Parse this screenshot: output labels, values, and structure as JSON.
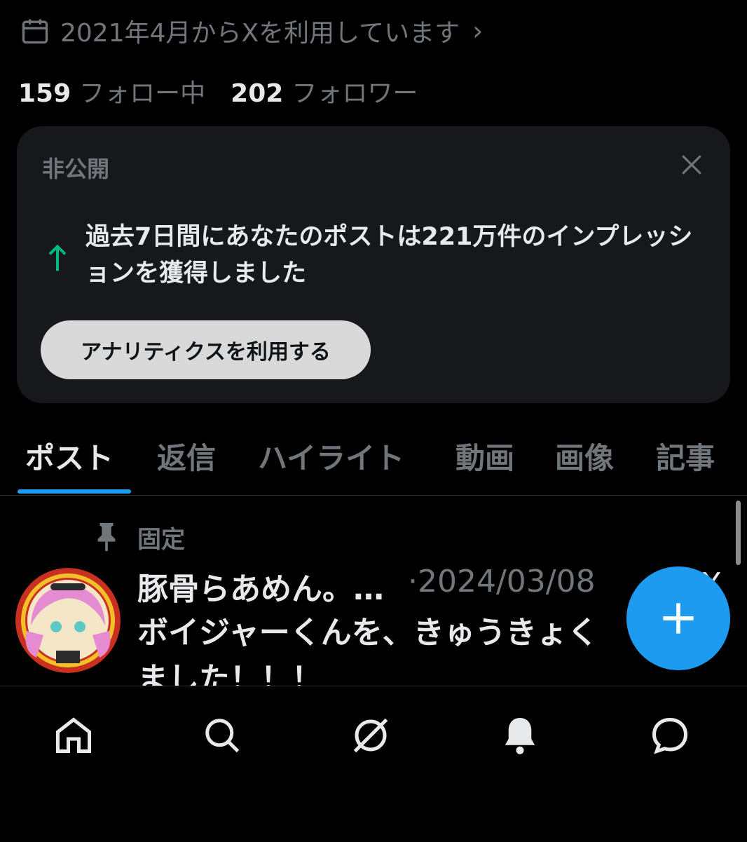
{
  "profile": {
    "joined_text": "2021年4月からXを利用しています",
    "following_count": "159",
    "following_label": "フォロー中",
    "followers_count": "202",
    "followers_label": "フォロワー"
  },
  "analytics_card": {
    "private_label": "非公開",
    "message": "過去7日間にあなたのポストは221万件のインプレッションを獲得しました",
    "button_label": "アナリティクスを利用する",
    "trend_color": "#00ba7c"
  },
  "tabs": [
    {
      "label": "ポスト",
      "active": true
    },
    {
      "label": "返信",
      "active": false
    },
    {
      "label": "ハイライト",
      "active": false
    },
    {
      "label": "動画",
      "active": false
    },
    {
      "label": "画像",
      "active": false
    },
    {
      "label": "記事",
      "active": false
    }
  ],
  "pinned_post": {
    "pinned_label": "固定",
    "author": "豚骨らあめん。…",
    "date": "·2024/03/08",
    "text": "ボイジャーくんを、きゅうきょく",
    "text_line2": "ました！！！"
  },
  "colors": {
    "accent": "#1d9bf0",
    "background": "#000000",
    "card_bg": "#16181c",
    "muted": "#71767b"
  },
  "bottom_nav": [
    "home-icon",
    "search-icon",
    "grok-icon",
    "bell-icon",
    "messages-icon"
  ]
}
